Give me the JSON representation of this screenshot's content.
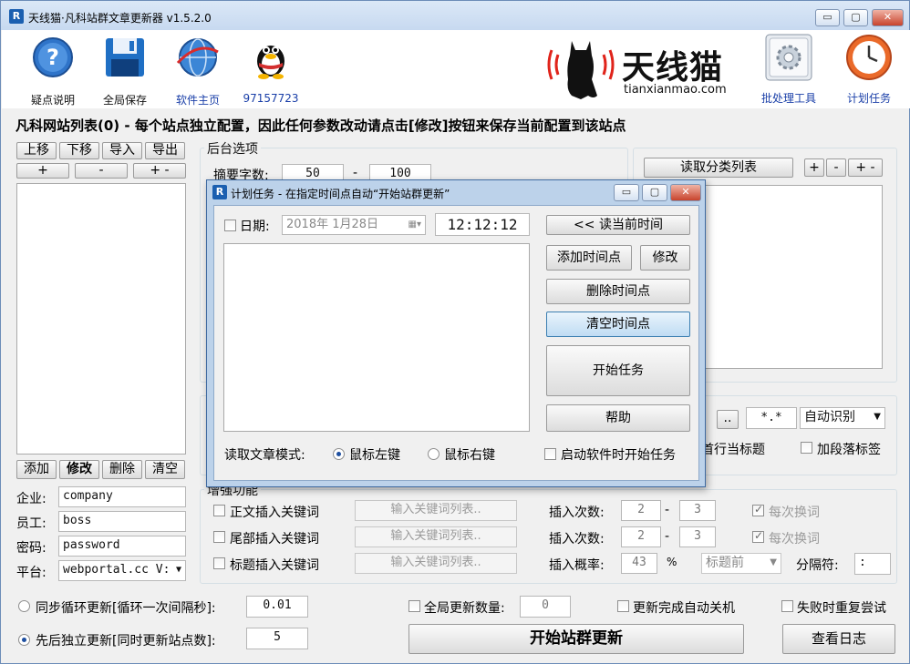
{
  "window": {
    "title": "天线猫·凡科站群文章更新器 v1.5.2.0",
    "min": "▭",
    "max": "▢",
    "close": "✕"
  },
  "toolbar": {
    "help": "疑点说明",
    "save": "全局保存",
    "home": "软件主页",
    "qq": "97157723",
    "brand_name": "天线猫",
    "brand_url": "tianxianmao.com",
    "batch": "批处理工具",
    "plan": "计划任务"
  },
  "headline": "凡科网站列表(0) - 每个站点独立配置，因此任何参数改动请点击[修改]按钮来保存当前配置到该站点",
  "site_list": {
    "up": "上移",
    "down": "下移",
    "import": "导入",
    "export": "导出",
    "plus": "+",
    "minus": "-",
    "plusminus": "+ -",
    "add": "添加",
    "modify": "修改",
    "delete": "删除",
    "clear": "清空"
  },
  "account": {
    "company_label": "企业:",
    "company_value": "company",
    "staff_label": "员工:",
    "staff_value": "boss",
    "password_label": "密码:",
    "password_value": "password",
    "platform_label": "平台:",
    "platform_value": "webportal.cc V:"
  },
  "backend": {
    "title": "后台选项",
    "summary_label": "摘要字数:",
    "summary_min": "50",
    "dash": "-",
    "summary_max": "100"
  },
  "category": {
    "read_button": "读取分类列表",
    "plus": "+",
    "minus": "-",
    "plusminus": "+ -"
  },
  "file_opts": {
    "browse": "..",
    "pattern": "*.*",
    "encoding": "自动识别",
    "first_line_title": "首行当标题",
    "add_paragraph_tag": "加段落标签"
  },
  "enhance": {
    "title": "增强功能",
    "rows": [
      {
        "label": "正文插入关键词",
        "btn": "输入关键词列表..",
        "count_label": "插入次数:",
        "a": "2",
        "dash": "-",
        "b": "3",
        "tail": "每次换词"
      },
      {
        "label": "尾部插入关键词",
        "btn": "输入关键词列表..",
        "count_label": "插入次数:",
        "a": "2",
        "dash": "-",
        "b": "3",
        "tail": "每次换词"
      }
    ],
    "title_row": {
      "label": "标题插入关键词",
      "btn": "输入关键词列表..",
      "rate_label": "插入概率:",
      "rate": "43",
      "pct": "%",
      "pos": "标题前",
      "sep_label": "分隔符:",
      "sep": ":"
    }
  },
  "bottom": {
    "sync_label": "同步循环更新[循环一次间隔秒]:",
    "sync_value": "0.01",
    "seq_label": "先后独立更新[同时更新站点数]:",
    "seq_value": "5",
    "global_count_label": "全局更新数量:",
    "global_count_value": "0",
    "auto_shutdown": "更新完成自动关机",
    "retry": "失败时重复尝试",
    "start": "开始站群更新",
    "log": "查看日志"
  },
  "dialog": {
    "title": "计划任务 - 在指定时间点自动“开始站群更新”",
    "date_label": "日期:",
    "date_value": "2018年 1月28日",
    "time_value": "12:12:12",
    "read_time": "<< 读当前时间",
    "add_point": "添加时间点",
    "modify": "修改",
    "delete_point": "删除时间点",
    "clear_points": "清空时间点",
    "start_task": "开始任务",
    "help": "帮助",
    "read_mode_label": "读取文章模式:",
    "left_click": "鼠标左键",
    "right_click": "鼠标右键",
    "autostart": "启动软件时开始任务"
  },
  "colors": {
    "accent": "#1b5fb0",
    "brand_red": "#e0241b",
    "title_bg": "#c7d9f0"
  }
}
